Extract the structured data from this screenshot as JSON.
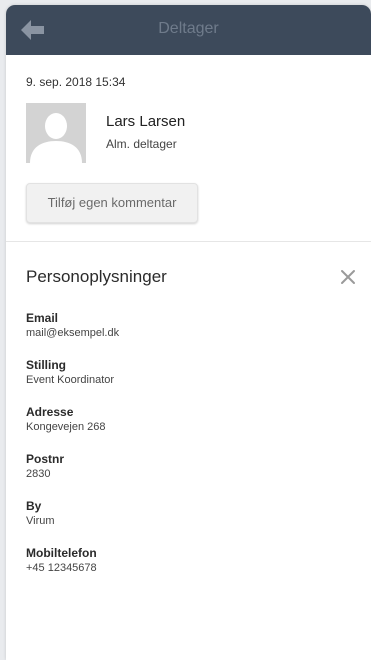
{
  "header": {
    "title": "Deltager",
    "back_icon": "arrow-left-icon"
  },
  "entry": {
    "timestamp": "9. sep. 2018 15:34"
  },
  "person": {
    "name": "Lars Larsen",
    "role": "Alm. deltager",
    "avatar_icon": "person-silhouette-icon"
  },
  "actions": {
    "add_comment_label": "Tilføj egen kommentar"
  },
  "details": {
    "title": "Personoplysninger",
    "close_icon": "close-icon",
    "fields": [
      {
        "label": "Email",
        "value": "mail@eksempel.dk"
      },
      {
        "label": "Stilling",
        "value": "Event Koordinator"
      },
      {
        "label": "Adresse",
        "value": "Kongevejen 268"
      },
      {
        "label": "Postnr",
        "value": "2830"
      },
      {
        "label": "By",
        "value": "Virum"
      },
      {
        "label": "Mobiltelefon",
        "value": "+45 12345678"
      }
    ]
  },
  "colors": {
    "header_bg": "#3d4a5b",
    "header_text": "#6f7b8b",
    "background": "#e9ebee"
  }
}
